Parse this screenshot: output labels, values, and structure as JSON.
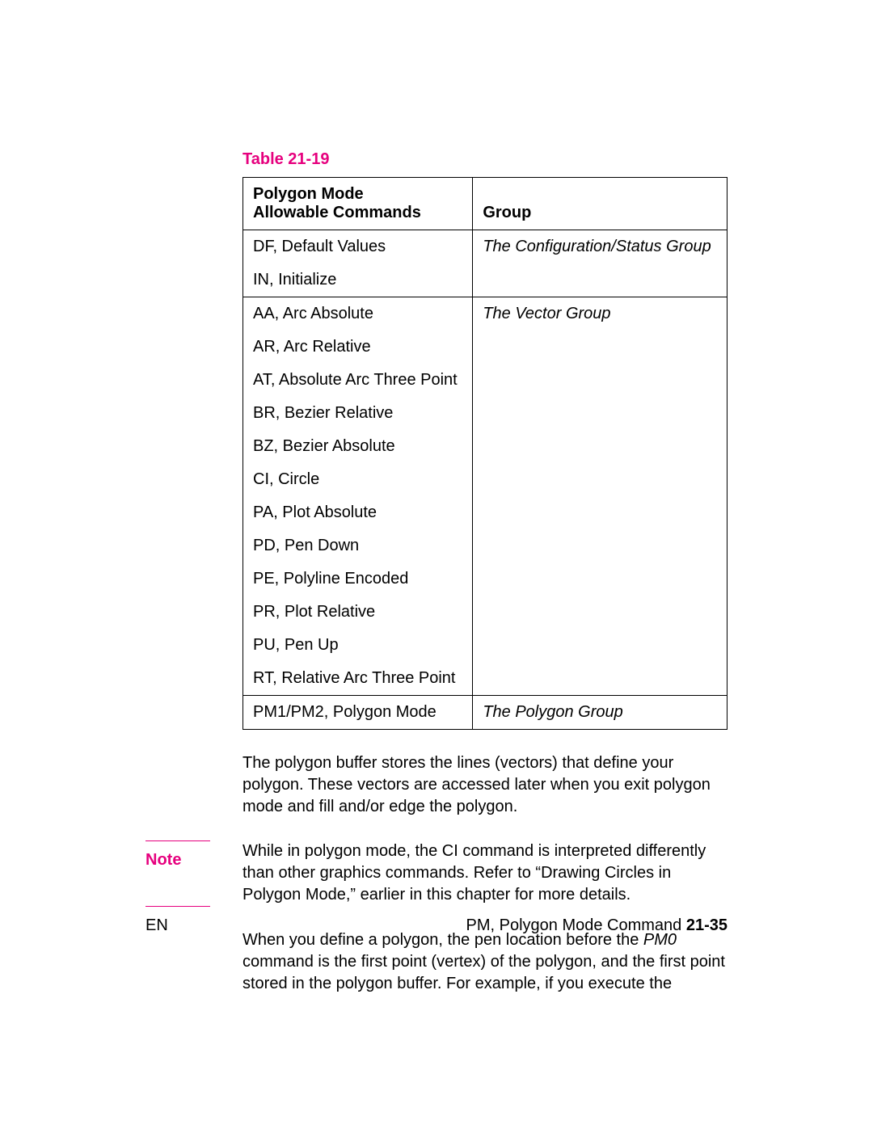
{
  "table": {
    "caption": "Table 21-19",
    "header": {
      "col1_line1": "Polygon Mode",
      "col1_line2": "Allowable Commands",
      "col2": "Group"
    },
    "group1": {
      "rows": [
        "DF, Default Values",
        "IN, Initialize"
      ],
      "group": "The Configuration/Status Group"
    },
    "group2": {
      "rows": [
        "AA, Arc Absolute",
        "AR, Arc Relative",
        "AT, Absolute Arc Three Point",
        "BR, Bezier Relative",
        "BZ, Bezier Absolute",
        "CI, Circle",
        "PA, Plot Absolute",
        "PD, Pen Down",
        "PE, Polyline Encoded",
        "PR, Plot Relative",
        "PU, Pen Up",
        "RT, Relative Arc Three Point"
      ],
      "group": "The Vector Group"
    },
    "group3": {
      "rows": [
        "PM1/PM2, Polygon Mode"
      ],
      "group": "The Polygon Group"
    }
  },
  "paragraphs": {
    "p1": "The polygon buffer stores the lines (vectors) that define your polygon. These vectors are accessed later when you exit polygon mode and fill and/or edge the polygon.",
    "note_label": "Note",
    "note_text": "While in polygon mode, the CI command is interpreted differently than other graphics commands. Refer to “Drawing Circles in Polygon Mode,” earlier in this chapter for more details.",
    "p2_part1": "When you define a polygon, the pen location before the ",
    "p2_pm0": "PM0",
    "p2_part2": " command is the first point (vertex) of the polygon, and the first point stored in the polygon buffer. For example, if you execute the"
  },
  "footer": {
    "left": "EN",
    "right_text": "PM, Polygon Mode Command ",
    "right_page": "21-35"
  }
}
